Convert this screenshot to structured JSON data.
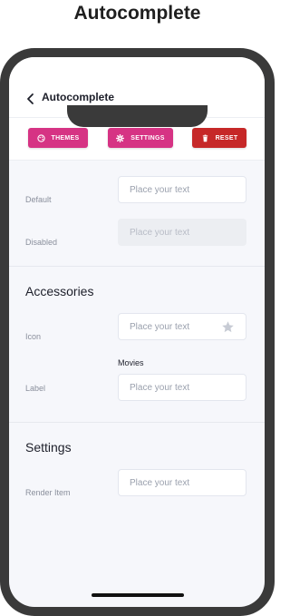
{
  "page": {
    "heading": "Autocomplete"
  },
  "header": {
    "title": "Autocomplete",
    "back_icon": "chevron-left-icon"
  },
  "toolbar": {
    "themes": {
      "label": "THEMES",
      "icon": "palette-icon",
      "color": "#d63384"
    },
    "settings": {
      "label": "SETTINGS",
      "icon": "gear-icon",
      "color": "#d63384"
    },
    "reset": {
      "label": "RESET",
      "icon": "trash-icon",
      "color": "#c62828"
    }
  },
  "rows": {
    "default": {
      "label": "Default",
      "placeholder": "Place your text"
    },
    "disabled": {
      "label": "Disabled",
      "placeholder": "Place your text"
    }
  },
  "accessories": {
    "title": "Accessories",
    "icon_row": {
      "label": "Icon",
      "placeholder": "Place your text",
      "icon": "star-icon"
    },
    "label_row": {
      "label": "Label",
      "field_label": "Movies",
      "placeholder": "Place your text"
    }
  },
  "settings_section": {
    "title": "Settings",
    "render_item": {
      "label": "Render Item",
      "placeholder": "Place your text"
    }
  }
}
